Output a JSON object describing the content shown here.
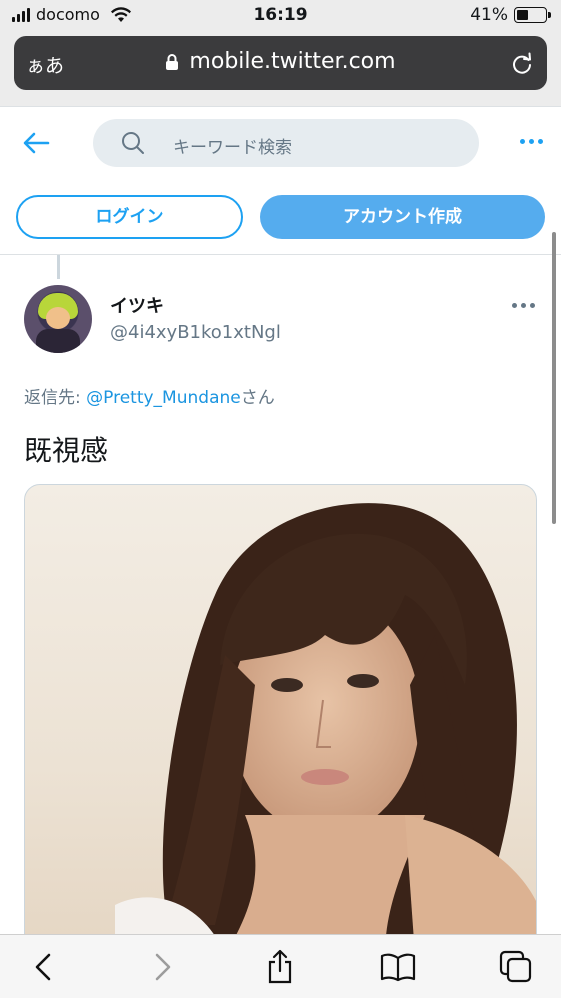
{
  "status_bar": {
    "carrier": "docomo",
    "time": "16:19",
    "battery_text": "41%",
    "battery_level": 0.41,
    "icons": [
      "signal-icon",
      "wifi-icon",
      "battery-icon"
    ]
  },
  "browser": {
    "text_size_label": "ぁあ",
    "url": "mobile.twitter.com",
    "icons": [
      "lock-icon",
      "reload-icon"
    ]
  },
  "twitter_header": {
    "search_placeholder": "キーワード検索",
    "login_label": "ログイン",
    "signup_label": "アカウント作成",
    "icons": [
      "back-arrow-icon",
      "search-icon",
      "more-icon"
    ]
  },
  "tweet": {
    "display_name": "イツキ",
    "handle": "@4i4xyB1ko1xtNgl",
    "reply_prefix": "返信先: ",
    "reply_mention": "@Pretty_Mundane",
    "reply_suffix": "さん",
    "text": "既視感",
    "media_alt": "photo"
  },
  "toolbar": {
    "icons": [
      "back-icon",
      "forward-icon",
      "share-icon",
      "bookmarks-icon",
      "tabs-icon"
    ]
  },
  "colors": {
    "twitter_blue": "#1da1f2",
    "signup_button": "#55acee",
    "mention": "#1b95e0",
    "url_bar": "#3b3b3d",
    "secondary_text": "#657786"
  }
}
